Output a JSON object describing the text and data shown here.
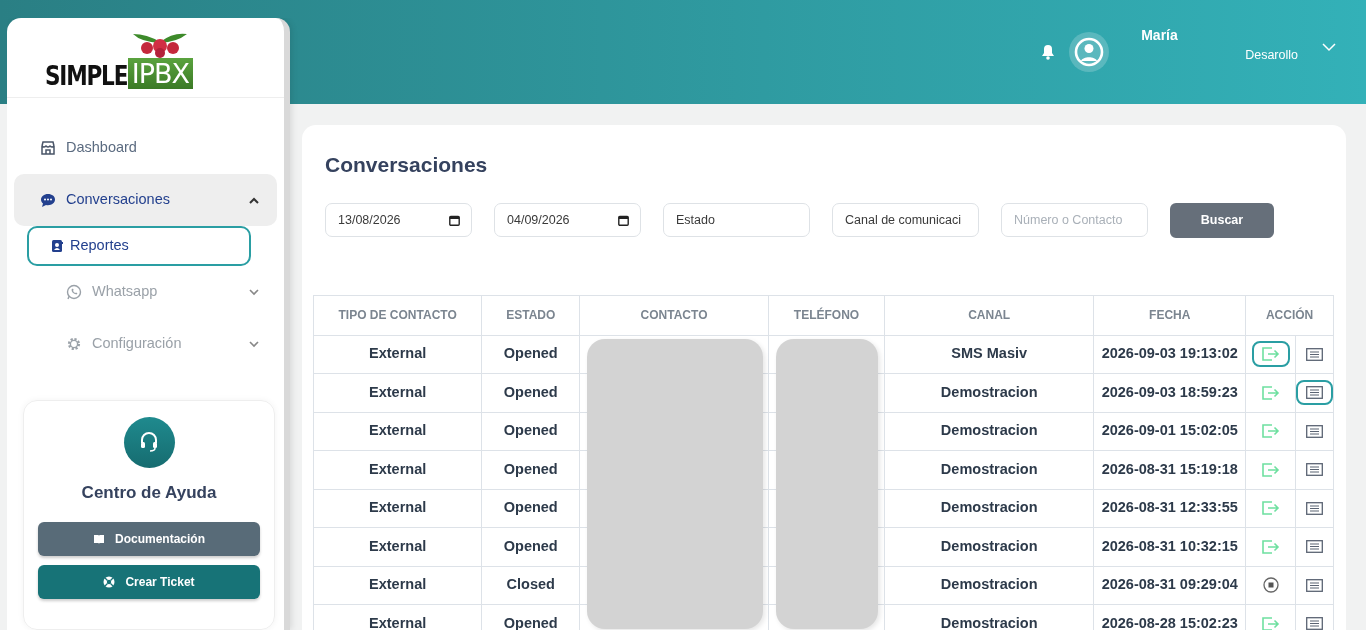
{
  "header": {
    "user_name": "María",
    "user_role": "Desarollo"
  },
  "logo": {
    "word": "SIMPLE",
    "badge": "IPBX"
  },
  "sidebar": {
    "items": [
      {
        "label": "Dashboard",
        "selected": false
      },
      {
        "label": "Conversaciones",
        "selected": true,
        "expanded": true,
        "children": [
          {
            "label": "Reportes",
            "selected": true
          }
        ]
      },
      {
        "label": "Whatsapp",
        "selected": false,
        "expanded": false
      },
      {
        "label": "Configuración",
        "selected": false,
        "expanded": false
      }
    ]
  },
  "help": {
    "title": "Centro de Ayuda",
    "buttons": [
      {
        "label": "Documentación",
        "kind": "docs"
      },
      {
        "label": "Crear Ticket",
        "kind": "ticket"
      }
    ]
  },
  "page_title": "Conversaciones",
  "filters": [
    {
      "kind": "date",
      "value": "13/08/2026"
    },
    {
      "kind": "date",
      "value": "04/09/2026"
    },
    {
      "kind": "select",
      "value": "Estado"
    },
    {
      "kind": "select",
      "value": "Canal de comunicaci"
    },
    {
      "kind": "text",
      "placeholder": "Número o Contacto"
    }
  ],
  "search_button": "Buscar",
  "table": {
    "columns": [
      "TIPO DE CONTACTO",
      "ESTADO",
      "CONTACTO",
      "TELÉFONO",
      "CANAL",
      "FECHA",
      "ACCIÓN"
    ],
    "rows": [
      {
        "type": "External",
        "status": "Opened",
        "channel": "SMS Masiv",
        "date": "2026-09-03 19:13:02",
        "action": {
          "kind": "open",
          "highlighted": true
        },
        "detail": {
          "highlighted": false
        }
      },
      {
        "type": "External",
        "status": "Opened",
        "channel": "Demostracion",
        "date": "2026-09-03 18:59:23",
        "action": {
          "kind": "open",
          "highlighted": false
        },
        "detail": {
          "highlighted": true
        }
      },
      {
        "type": "External",
        "status": "Opened",
        "channel": "Demostracion",
        "date": "2026-09-01 15:02:05",
        "action": {
          "kind": "open",
          "highlighted": false
        },
        "detail": {
          "highlighted": false
        }
      },
      {
        "type": "External",
        "status": "Opened",
        "channel": "Demostracion",
        "date": "2026-08-31 15:19:18",
        "action": {
          "kind": "open",
          "highlighted": false
        },
        "detail": {
          "highlighted": false
        }
      },
      {
        "type": "External",
        "status": "Opened",
        "channel": "Demostracion",
        "date": "2026-08-31 12:33:55",
        "action": {
          "kind": "open",
          "highlighted": false
        },
        "detail": {
          "highlighted": false
        }
      },
      {
        "type": "External",
        "status": "Opened",
        "channel": "Demostracion",
        "date": "2026-08-31 10:32:15",
        "action": {
          "kind": "open",
          "highlighted": false
        },
        "detail": {
          "highlighted": false
        }
      },
      {
        "type": "External",
        "status": "Closed",
        "channel": "Demostracion",
        "date": "2026-08-31 09:29:04",
        "action": {
          "kind": "closed",
          "highlighted": false
        },
        "detail": {
          "highlighted": false
        }
      },
      {
        "type": "External",
        "status": "Opened",
        "channel": "Demostracion",
        "date": "2026-08-28 15:02:23",
        "action": {
          "kind": "open",
          "highlighted": false
        },
        "detail": {
          "highlighted": false
        }
      }
    ]
  }
}
